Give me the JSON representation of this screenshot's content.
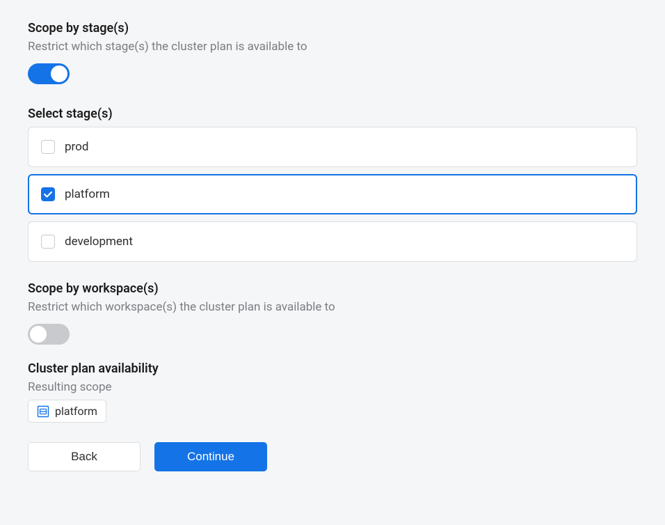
{
  "scope_stage": {
    "heading": "Scope by stage(s)",
    "desc": "Restrict which stage(s) the cluster plan is available to",
    "enabled": true
  },
  "select_stages": {
    "heading": "Select stage(s)",
    "items": [
      {
        "label": "prod",
        "checked": false
      },
      {
        "label": "platform",
        "checked": true
      },
      {
        "label": "development",
        "checked": false
      }
    ]
  },
  "scope_workspace": {
    "heading": "Scope by workspace(s)",
    "desc": "Restrict which workspace(s) the cluster plan is available to",
    "enabled": false
  },
  "availability": {
    "heading": "Cluster plan availability",
    "sub": "Resulting scope",
    "chips": [
      {
        "label": "platform"
      }
    ]
  },
  "footer": {
    "back": "Back",
    "continue": "Continue"
  },
  "colors": {
    "primary": "#1473e6"
  }
}
